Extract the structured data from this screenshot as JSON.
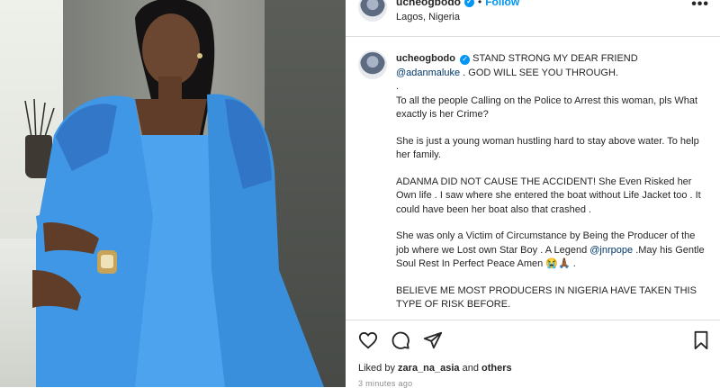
{
  "post": {
    "username": "ucheogbodo",
    "follow_label": "Follow",
    "dot_separator": "•",
    "location": "Lagos, Nigeria",
    "more_label": "•••"
  },
  "caption": {
    "username": "ucheogbodo",
    "line1_text": "STAND STRONG MY DEAR FRIEND",
    "mention1": "@adanmaluke",
    "line1_rest": ". GOD WILL SEE YOU THROUGH.",
    "dot_line": ".",
    "para2": "To all the people Calling on the Police to Arrest this woman, pls What exactly is her Crime?",
    "para3": "She is just a young woman hustling hard to stay above water. To help her family.",
    "para4": "ADANMA DID NOT CAUSE THE ACCIDENT! She Even Risked her Own life . I saw where she entered the boat without Life Jacket too . It could have been her boat also that crashed .",
    "para5_start": "She was only a Victim of Circumstance by Being the Producer of the job where we Lost own Star Boy . A Legend",
    "mention2": "@jnrpope",
    "para5_end": ".May his Gentle Soul Rest In Perfect Peace Amen 😭🙏🏾 .",
    "para6": "BELIEVE ME MOST PRODUCERS IN NIGERIA HAVE TAKEN THIS TYPE OF RISK BEFORE."
  },
  "engagement": {
    "liked_by_prefix": "Liked by",
    "liked_by_user": "zara_na_asia",
    "and_label": "and",
    "others_label": "others",
    "time_ago": "3 minutes ago"
  },
  "colors": {
    "accent": "#0095f6",
    "mention": "#00376b",
    "muted": "#8e8e8e",
    "outfit_blue": "#3f97e6"
  },
  "icons": {
    "like": "heart-icon",
    "comment": "comment-icon",
    "share": "share-icon",
    "save": "bookmark-icon",
    "verified": "verified-badge-icon",
    "more": "more-options-icon"
  }
}
